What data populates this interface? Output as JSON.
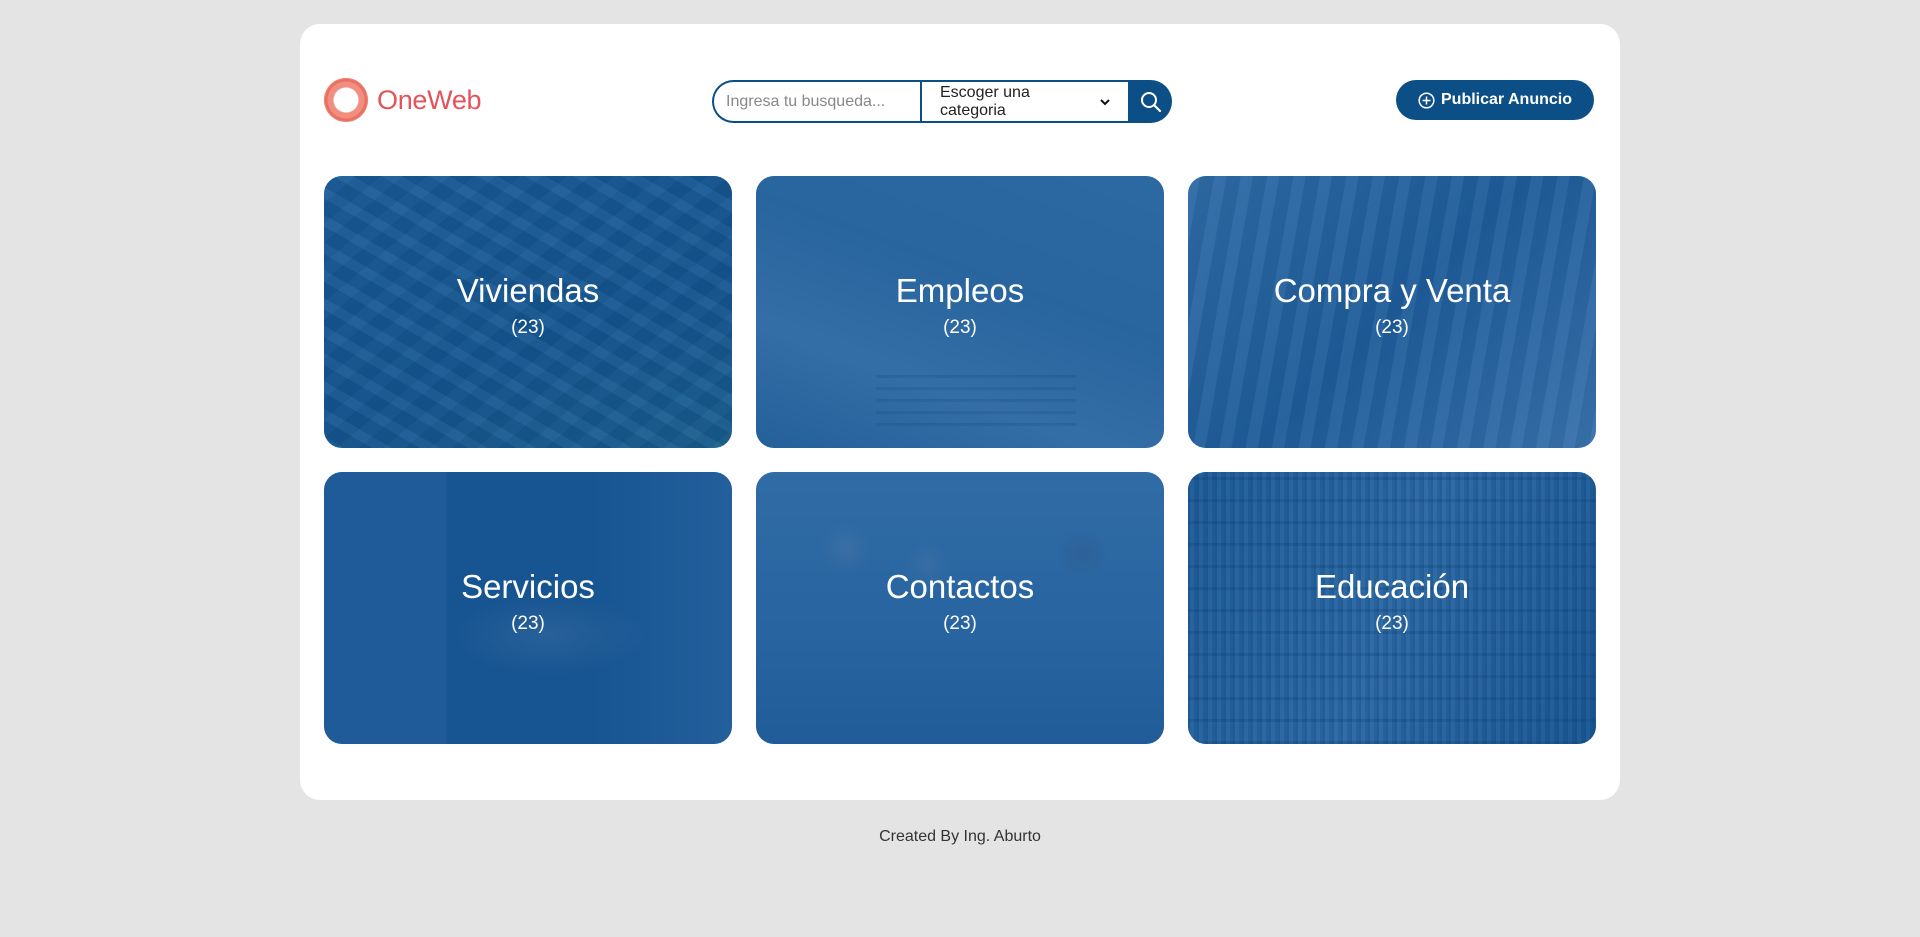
{
  "brand": {
    "name": "OneWeb"
  },
  "search": {
    "placeholder": "Ingresa tu busqueda...",
    "category_selected": "Escoger una categoria"
  },
  "publish_button": {
    "label": "Publicar Anuncio"
  },
  "categories": [
    {
      "title": "Viviendas",
      "count": "(23)",
      "icon": "houses-photo"
    },
    {
      "title": "Empleos",
      "count": "(23)",
      "icon": "laptop-photo"
    },
    {
      "title": "Compra y Venta",
      "count": "(23)",
      "icon": "shopping-photo"
    },
    {
      "title": "Servicios",
      "count": "(23)",
      "icon": "handshake-photo"
    },
    {
      "title": "Contactos",
      "count": "(23)",
      "icon": "people-photo"
    },
    {
      "title": "Educación",
      "count": "(23)",
      "icon": "library-photo"
    }
  ],
  "footer": {
    "text": "Created By Ing. Aburto"
  },
  "colors": {
    "primary": "#0c4f87",
    "brand": "#e5535a",
    "background": "#e4e4e4"
  }
}
